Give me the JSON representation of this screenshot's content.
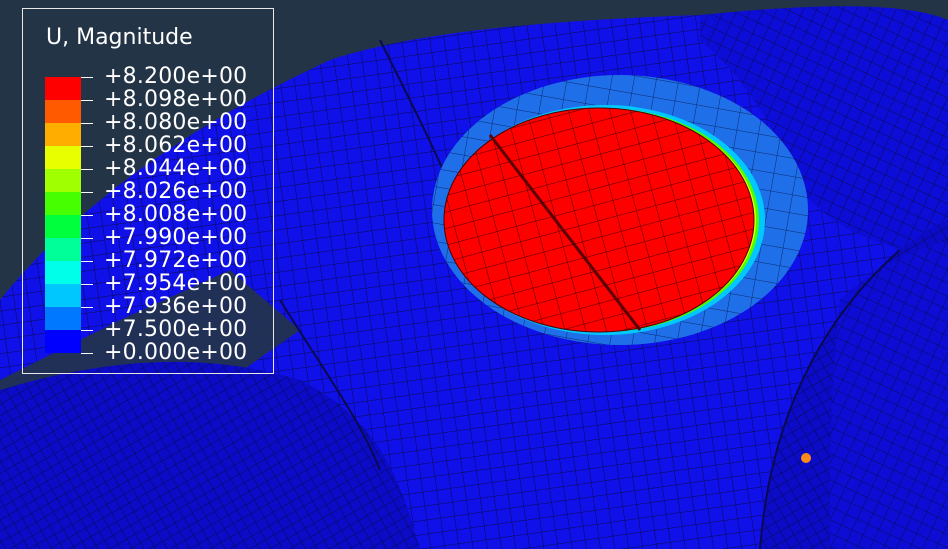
{
  "legend": {
    "title": "U, Magnitude",
    "levels": [
      {
        "label": "+8.200e+00",
        "color": "#ff0000"
      },
      {
        "label": "+8.098e+00",
        "color": "#ff5a00"
      },
      {
        "label": "+8.080e+00",
        "color": "#ffae00"
      },
      {
        "label": "+8.062e+00",
        "color": "#e8ff00"
      },
      {
        "label": "+8.044e+00",
        "color": "#a0ff00"
      },
      {
        "label": "+8.026e+00",
        "color": "#46ff00"
      },
      {
        "label": "+8.008e+00",
        "color": "#00ff3c"
      },
      {
        "label": "+7.990e+00",
        "color": "#00ff99"
      },
      {
        "label": "+7.972e+00",
        "color": "#00ffe8"
      },
      {
        "label": "+7.954e+00",
        "color": "#00c8ff"
      },
      {
        "label": "+7.936e+00",
        "color": "#0078ff"
      },
      {
        "label": "+7.500e+00",
        "color": "#0028ff"
      },
      {
        "label": "+0.000e+00",
        "color": ""
      }
    ],
    "low_color": "#0000ff"
  },
  "colors": {
    "background": "#243447",
    "mesh_line": "#0a0a50",
    "probe": "#ff8c1a"
  }
}
